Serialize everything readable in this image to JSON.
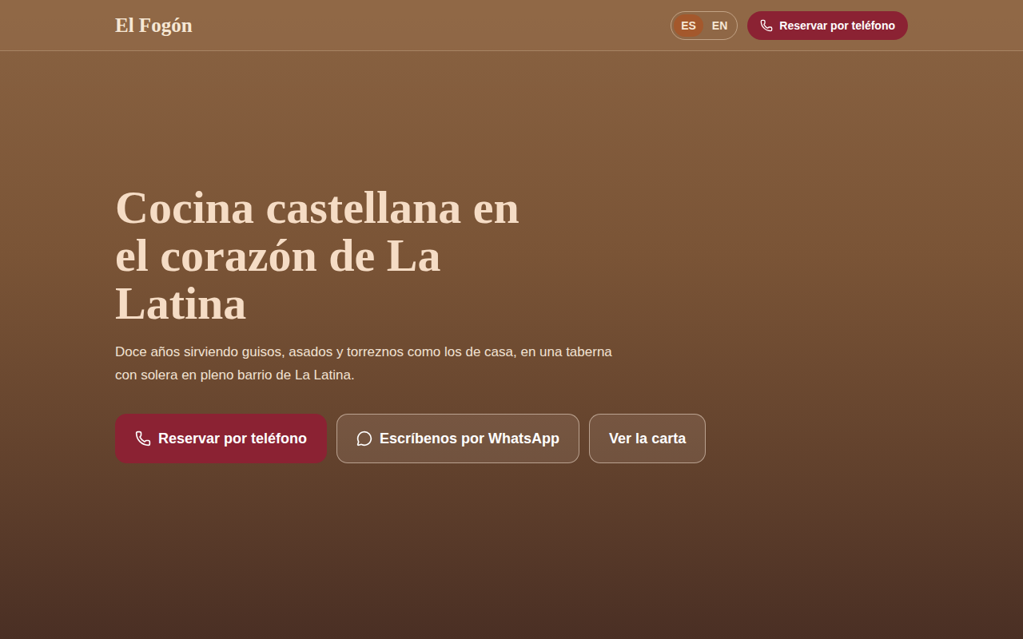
{
  "header": {
    "logo": "El Fogón",
    "languages": [
      {
        "label": "ES",
        "selected": true
      },
      {
        "label": "EN",
        "selected": false
      }
    ],
    "reserve_button": "Reservar por teléfono"
  },
  "hero": {
    "title": "Cocina castellana en el corazón de La Latina",
    "subtitle": "Doce años sirviendo guisos, asados y torreznos como los de casa, en una taberna con solera en pleno barrio de La Latina.",
    "buttons": [
      {
        "label": "Reservar por teléfono",
        "kind": "call"
      },
      {
        "label": "Escríbenos por WhatsApp",
        "kind": "chat"
      },
      {
        "label": "Ver la carta",
        "kind": "plain"
      }
    ]
  }
}
